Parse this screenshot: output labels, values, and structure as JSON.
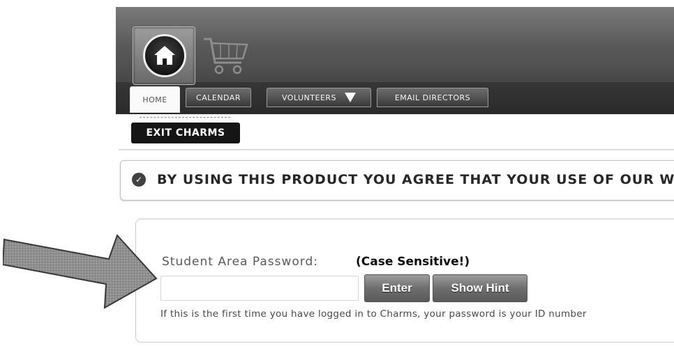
{
  "header": {
    "home_icon": "home-icon",
    "cart_icon": "shopping-cart-icon",
    "tabs": [
      {
        "label": "HOME",
        "active": true
      },
      {
        "label": "CALENDAR",
        "active": false
      },
      {
        "label": "VOLUNTEERS",
        "active": false,
        "icon": "dropdown-arrow-icon"
      },
      {
        "label": "EMAIL DIRECTORS",
        "active": false
      }
    ]
  },
  "exit_button": {
    "label": "EXIT CHARMS"
  },
  "notice": {
    "icon": "check-circle-icon",
    "text": "BY USING THIS PRODUCT YOU AGREE THAT YOUR USE OF OUR WEB"
  },
  "login": {
    "label": "Student Area Password:",
    "case_note": "(Case Sensitive!)",
    "password_value": "",
    "enter_label": "Enter",
    "hint_label": "Show Hint",
    "help_text": "If this is the first time you have logged in to Charms, your password is your ID number"
  },
  "annotation": {
    "icon": "pointer-arrow-icon"
  },
  "colors": {
    "banner": "#5c5c5c",
    "exit_button": "#1a1a1a",
    "button": "#6f6f6f"
  }
}
